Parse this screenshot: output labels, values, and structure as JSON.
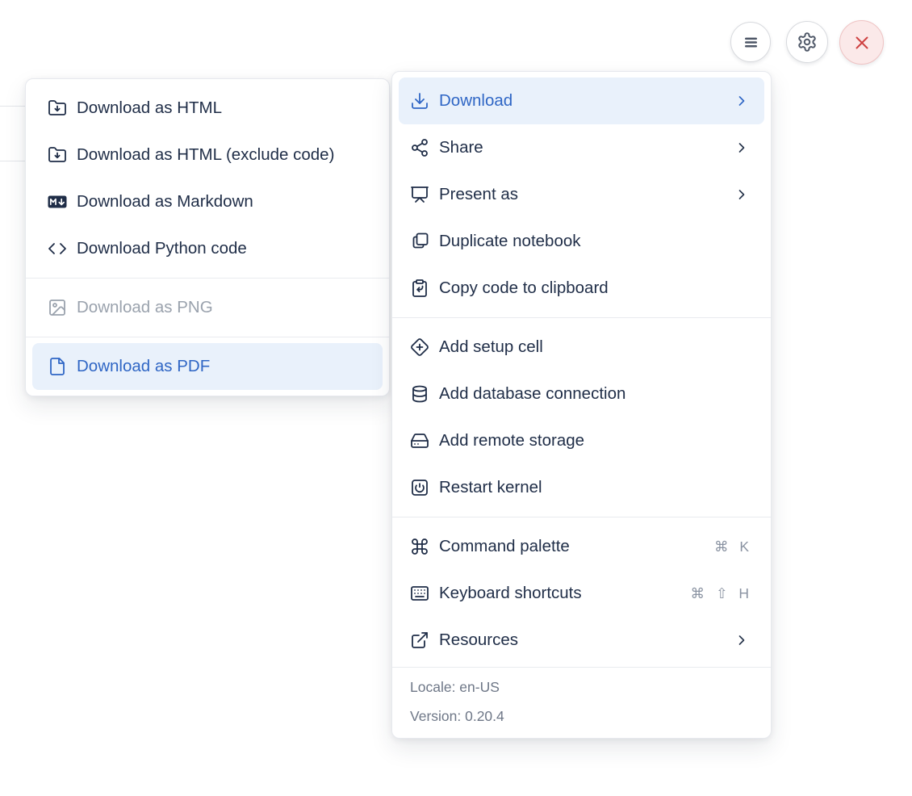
{
  "topbar": {
    "buttons": [
      {
        "name": "notebook-menu-button",
        "icon": "menu-icon"
      },
      {
        "name": "settings-button",
        "icon": "gear-icon"
      },
      {
        "name": "shutdown-button",
        "icon": "close-icon"
      }
    ]
  },
  "submenu": {
    "items": [
      {
        "label": "Download as HTML",
        "icon": "folder-down-icon",
        "state": "normal"
      },
      {
        "label": "Download as HTML (exclude code)",
        "icon": "folder-down-icon",
        "state": "normal"
      },
      {
        "label": "Download as Markdown",
        "icon": "markdown-download-icon",
        "state": "normal"
      },
      {
        "label": "Download Python code",
        "icon": "code-icon",
        "state": "normal"
      },
      {
        "label": "Download as PNG",
        "icon": "image-icon",
        "state": "disabled"
      },
      {
        "label": "Download as PDF",
        "icon": "file-icon",
        "state": "highlighted"
      }
    ]
  },
  "menu": {
    "items": [
      {
        "label": "Download",
        "icon": "download-icon",
        "has_submenu": true,
        "state": "highlighted"
      },
      {
        "label": "Share",
        "icon": "share-icon",
        "has_submenu": true
      },
      {
        "label": "Present as",
        "icon": "presentation-icon",
        "has_submenu": true
      },
      {
        "label": "Duplicate notebook",
        "icon": "duplicate-icon"
      },
      {
        "label": "Copy code to clipboard",
        "icon": "clipboard-copy-icon"
      },
      {
        "label": "Add setup cell",
        "icon": "diamond-plus-icon"
      },
      {
        "label": "Add database connection",
        "icon": "database-icon"
      },
      {
        "label": "Add remote storage",
        "icon": "hard-drive-icon"
      },
      {
        "label": "Restart kernel",
        "icon": "power-icon"
      },
      {
        "label": "Command palette",
        "icon": "command-icon",
        "shortcut": "⌘ K"
      },
      {
        "label": "Keyboard shortcuts",
        "icon": "keyboard-icon",
        "shortcut": "⌘ ⇧ H"
      },
      {
        "label": "Resources",
        "icon": "external-link-icon",
        "has_submenu": true
      }
    ],
    "footer": {
      "locale": "Locale: en-US",
      "version": "Version: 0.20.4"
    }
  },
  "colors": {
    "accent": "#2f66c5",
    "accent_bg": "#e9f1fb",
    "text": "#1f2d47",
    "disabled_text": "#9aa2ad",
    "footer_text": "#6e7787",
    "shortcut_text": "#8a93a2",
    "separator": "#e9ebef",
    "danger": "#ce4040",
    "danger_bg": "#fbe9e9",
    "danger_border": "#efc3c3",
    "button_border": "#d8dade"
  }
}
